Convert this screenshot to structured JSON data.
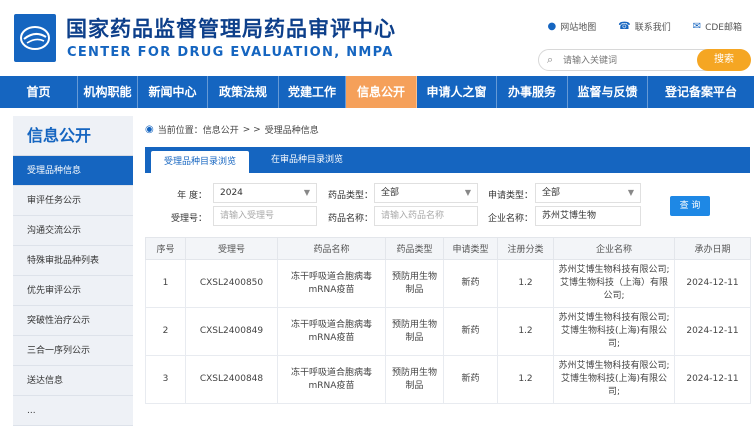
{
  "header": {
    "title_cn": "国家药品监督管理局药品审评中心",
    "title_en": "CENTER FOR DRUG EVALUATION, NMPA",
    "links": [
      {
        "icon": "location-pin-icon",
        "label": "网站地图"
      },
      {
        "icon": "phone-icon",
        "label": "联系我们"
      },
      {
        "icon": "mail-icon",
        "label": "CDE邮箱"
      }
    ],
    "search_placeholder": "请输入关键词",
    "search_button": "搜索"
  },
  "nav": {
    "items": [
      "首页",
      "机构职能",
      "新闻中心",
      "政策法规",
      "党建工作",
      "信息公开",
      "申请人之窗",
      "办事服务",
      "监督与反馈",
      "登记备案平台"
    ],
    "active_index": 5
  },
  "sidebar": {
    "title": "信息公开",
    "items": [
      "受理品种信息",
      "审评任务公示",
      "沟通交流公示",
      "特殊审批品种列表",
      "优先审评公示",
      "突破性治疗公示",
      "三合一序列公示",
      "送达信息",
      "..."
    ],
    "active_index": 0
  },
  "breadcrumb": {
    "prefix": "当前位置：信息公开",
    "sep": "> >",
    "current": "受理品种信息"
  },
  "tabs": [
    "受理品种目录浏览",
    "在审品种目录浏览"
  ],
  "form": {
    "year_label": "年    度：",
    "year_value": "2024",
    "drug_type_label": "药品类型：",
    "drug_type_value": "全部",
    "apply_type_label": "申请类型：",
    "apply_type_value": "全部",
    "accept_no_label": "受理号：",
    "accept_no_placeholder": "请输入受理号",
    "drug_name_label": "药品名称：",
    "drug_name_placeholder": "请输入药品名称",
    "company_label": "企业名称：",
    "company_value": "苏州艾博生物",
    "query_button": "查 询"
  },
  "table": {
    "headers": [
      "序号",
      "受理号",
      "药品名称",
      "药品类型",
      "申请类型",
      "注册分类",
      "企业名称",
      "承办日期"
    ],
    "rows": [
      [
        "1",
        "CXSL2400850",
        "冻干呼吸道合胞病毒mRNA疫苗",
        "预防用生物制品",
        "新药",
        "1.2",
        "苏州艾博生物科技有限公司;艾博生物科技（上海）有限公司;",
        "2024-12-11"
      ],
      [
        "2",
        "CXSL2400849",
        "冻干呼吸道合胞病毒mRNA疫苗",
        "预防用生物制品",
        "新药",
        "1.2",
        "苏州艾博生物科技有限公司;艾博生物科技(上海)有限公司;",
        "2024-12-11"
      ],
      [
        "3",
        "CXSL2400848",
        "冻干呼吸道合胞病毒mRNA疫苗",
        "预防用生物制品",
        "新药",
        "1.2",
        "苏州艾博生物科技有限公司;艾博生物科技(上海)有限公司;",
        "2024-12-11"
      ]
    ]
  }
}
